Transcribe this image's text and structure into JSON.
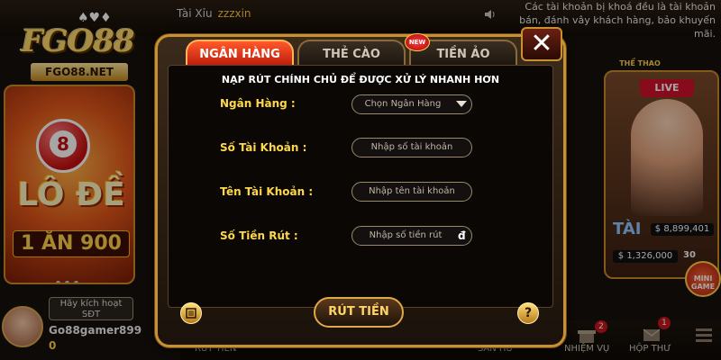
{
  "brand": {
    "logo_text": "FGO88",
    "logo_url_text": "FGO88.NET",
    "logo_cards_glyph": "♠♥♦"
  },
  "ticker": {
    "game": "Tài Xỉu",
    "user": "zzzxin"
  },
  "notice_text": "Các tài khoản bị khoá đều là tài khoản bán, đánh vây khách hàng, bảo khuyến mãi.",
  "left_card": {
    "ball_number": "8",
    "title": "LÔ ĐỀ",
    "banner": "1 ĂN 900"
  },
  "profile": {
    "activate_label": "Hãy kích hoạt SĐT",
    "username": "Go88gamer899",
    "balance": "0"
  },
  "right_card": {
    "category": "THỂ THAO",
    "live_label": "LIVE",
    "tai_label": "TÀI",
    "stat_top": "$ 8,899,401",
    "stat_bottom": "$ 1,326,000",
    "stat_count": "30",
    "mini_game_label": "MINI GAME"
  },
  "bottom_nav": [
    {
      "label": "RÚT TIỀN"
    },
    {
      "label": "SẢN HŨ"
    },
    {
      "label": "NHIỆM VỤ",
      "badge": "2"
    },
    {
      "label": "HỘP THƯ",
      "badge": "1"
    }
  ],
  "modal": {
    "tabs": [
      {
        "label": "NGÂN HÀNG",
        "active": true
      },
      {
        "label": "THẺ CÀO",
        "active": false
      },
      {
        "label": "TIỀN ẢO",
        "active": false
      }
    ],
    "new_badge": "NEW",
    "close_glyph": "✕",
    "notice": "NẠP RÚT CHÍNH CHỦ ĐỂ ĐƯỢC XỬ LÝ NHANH HƠN",
    "fields": {
      "bank": {
        "label": "Ngân Hàng :",
        "placeholder": "Chọn Ngân Hàng"
      },
      "account_number": {
        "label": "Số Tài Khoản :",
        "placeholder": "Nhập số tài  khoản"
      },
      "account_name": {
        "label": "Tên Tài Khoản :",
        "placeholder": "Nhập tên tài khoản"
      },
      "amount": {
        "label": "Số Tiền Rút :",
        "placeholder": "Nhập số tiền rút",
        "currency": "đ"
      }
    },
    "submit_label": "RÚT TIỀN",
    "help_glyph": "?"
  },
  "colors": {
    "accent_gold": "#ffd84a",
    "active_tab": "#e0401a",
    "modal_border": "#c8902f"
  }
}
